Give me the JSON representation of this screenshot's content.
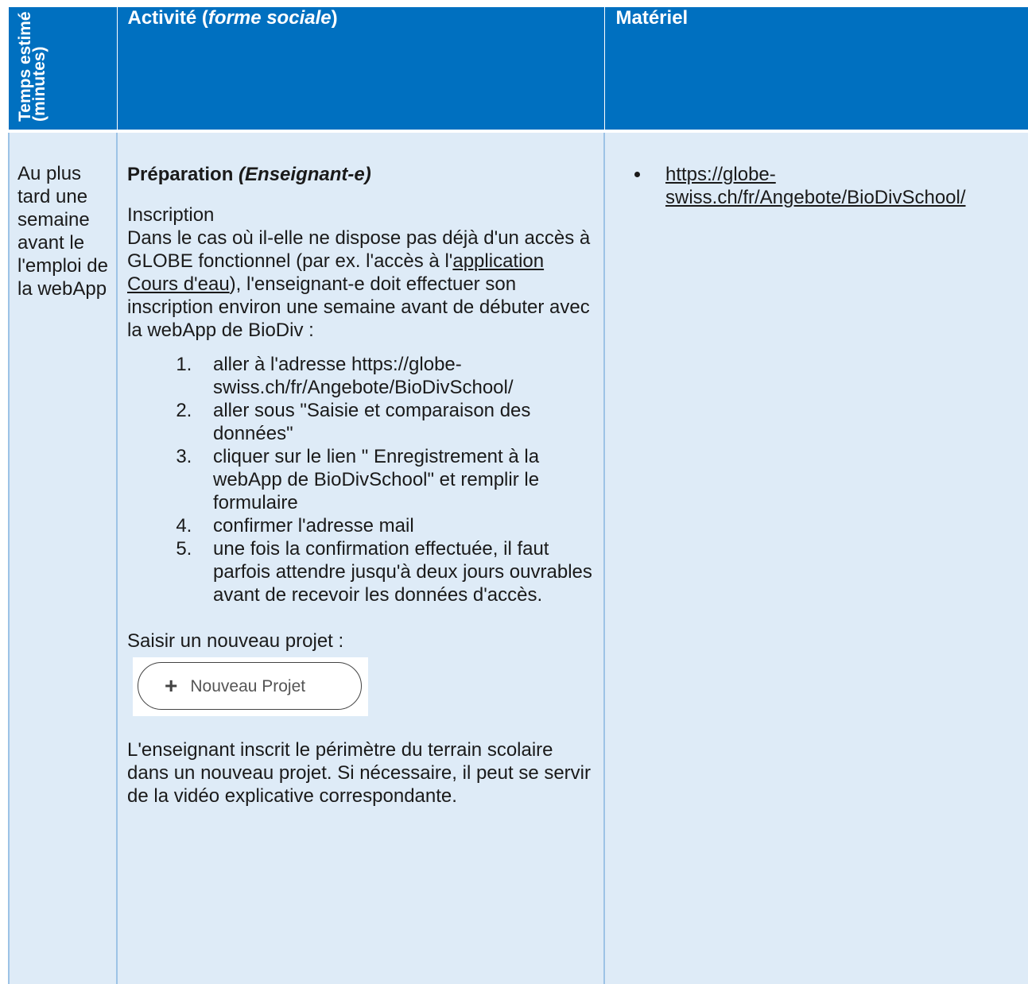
{
  "header": {
    "time_col": "Temps estimé (minutes)",
    "activity_col_main": "Activité (",
    "activity_col_italic": "forme sociale",
    "activity_col_end": ")",
    "material_col": "Matériel"
  },
  "row": {
    "time": "Au plus tard une semaine avant le l'emploi de la webApp",
    "heading_main": "Préparation",
    "heading_italic": "(Enseignant-e)",
    "subheading": "Inscription",
    "intro_part1": "Dans le cas où il-elle ne dispose pas déjà d'un accès à GLOBE fonctionnel (par ex. l'accès à l'",
    "intro_link": "application Cours d'eau",
    "intro_part2": "), l'enseignant-e doit effectuer son inscription environ une semaine avant de débuter avec la webApp de BioDiv :",
    "steps": [
      "aller à l'adresse https://globe-swiss.ch/fr/Angebote/BioDivSchool/",
      "aller sous \"Saisie et comparaison des données\"",
      "cliquer sur le lien \" Enregistrement à la webApp de BioDivSchool\" et remplir le formulaire",
      "confirmer l'adresse mail",
      "une fois la confirmation effectuée, il faut parfois attendre jusqu'à deux jours ouvrables avant de recevoir les données d'accès."
    ],
    "new_project_label": "Saisir un nouveau projet :",
    "new_project_button": "Nouveau Projet",
    "new_project_icon": "plus-icon",
    "closing": "L'enseignant inscrit le périmètre du terrain scolaire dans un nouveau projet. Si nécessaire, il peut se servir de la vidéo explicative correspondante.",
    "material_link": "https://globe-swiss.ch/fr/Angebote/BioDivSchool/"
  },
  "colors": {
    "header_bg": "#0070c0",
    "cell_bg": "#deebf7",
    "border": "#9dc3e6"
  }
}
